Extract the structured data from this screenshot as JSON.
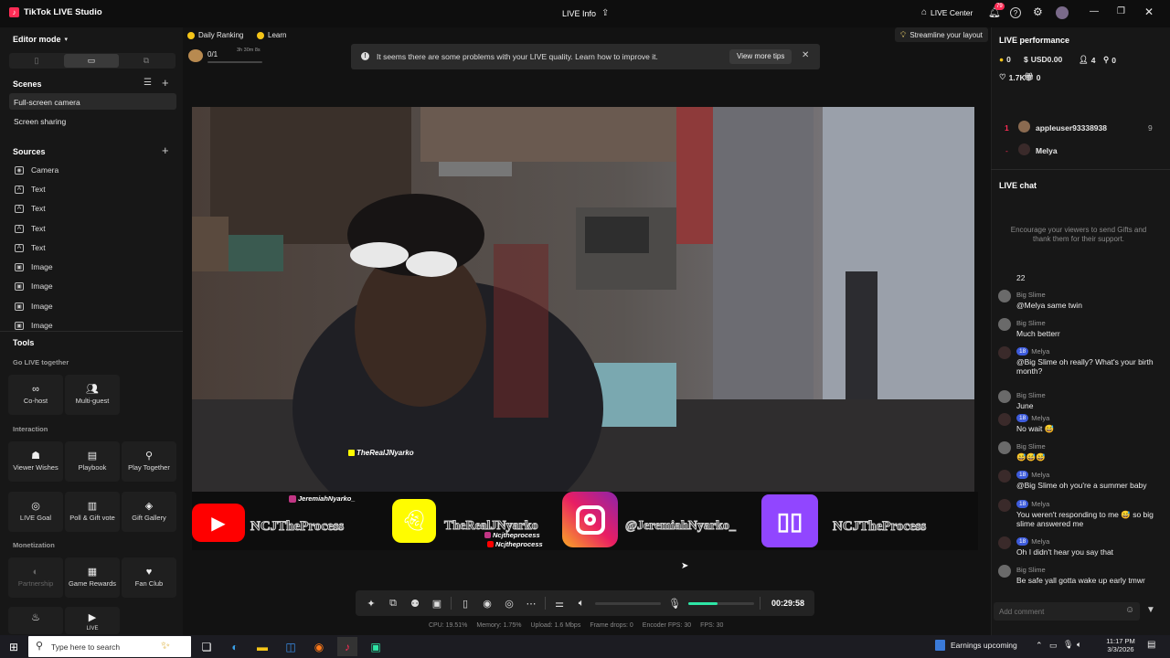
{
  "titlebar": {
    "app_name": "TikTok LIVE Studio",
    "center_title": "LIVE Info",
    "live_center": "LIVE Center",
    "notif_count": "79"
  },
  "left": {
    "editor_mode": "Editor mode",
    "scenes_title": "Scenes",
    "scenes": [
      "Full-screen camera",
      "Screen sharing"
    ],
    "sources_title": "Sources",
    "sources": [
      {
        "label": "Camera",
        "icon": "camera-icon"
      },
      {
        "label": "Text",
        "icon": "text-icon"
      },
      {
        "label": "Text",
        "icon": "text-icon"
      },
      {
        "label": "Text",
        "icon": "text-icon"
      },
      {
        "label": "Text",
        "icon": "text-icon"
      },
      {
        "label": "Image",
        "icon": "image-icon"
      },
      {
        "label": "Image",
        "icon": "image-icon"
      },
      {
        "label": "Image",
        "icon": "image-icon"
      },
      {
        "label": "Image",
        "icon": "image-icon"
      }
    ],
    "tools_title": "Tools",
    "go_live_together": "Go LIVE together",
    "cohost": "Co-host",
    "multiguest": "Multi-guest",
    "interaction": "Interaction",
    "viewer_wishes": "Viewer Wishes",
    "playbook": "Playbook",
    "play_together": "Play Together",
    "live_goal": "LIVE Goal",
    "poll_gift": "Poll & Gift vote",
    "gift_gallery": "Gift Gallery",
    "monetization": "Monetization",
    "partnership": "Partnership",
    "game_rewards": "Game Rewards",
    "fan_club": "Fan Club",
    "live_partial": "LIVE"
  },
  "center": {
    "daily_ranking": "Daily Ranking",
    "learn": "Learn",
    "goal_count": "0/1",
    "goal_time": "3h 30m 8s",
    "alert_text": "It seems there are some problems with your LIVE quality. Learn how to improve it.",
    "view_more_tips": "View more tips",
    "streamline": "Streamline your layout",
    "overlay_name": "TheRealJNyarko",
    "banner": {
      "ig_small": "JeremiahNyarko_",
      "youtube_name": "NCJTheProcess",
      "snap_name": "TheRealJNyarko",
      "snap_sub1": "Ncjtheprocess",
      "snap_sub2": "Ncjtheprocess",
      "ig_name": "@JeremiahNyarko_",
      "twitch_name": "NCJTheProcess"
    },
    "timer": "00:29:58",
    "mic_level": 0.45,
    "stats": {
      "cpu": "CPU: 19.51%",
      "memory": "Memory: 1.75%",
      "upload": "Upload: 1.6 Mbps",
      "drops": "Frame drops: 0",
      "enc_fps": "Encoder FPS: 30",
      "fps": "FPS: 30"
    }
  },
  "right": {
    "perf_title": "LIVE performance",
    "coins": "0",
    "usd": "USD0.00",
    "viewers": "4",
    "new_followers": "0",
    "likes": "1.7K",
    "gifts": "0",
    "rank1_num": "1",
    "rank1_name": "appleuser93338938",
    "rank1_score": "9",
    "rank2_num": "-",
    "rank2_name": "Melya",
    "chat_title": "LIVE chat",
    "chat_hint": "Encourage your viewers to send Gifts and thank them for their support.",
    "partial_msg": "22",
    "messages": [
      {
        "name": "Big Slime",
        "badge": "",
        "text": "@Melya same twin"
      },
      {
        "name": "Big Slime",
        "badge": "",
        "text": "Much betterr"
      },
      {
        "name": "Melya",
        "badge": "18",
        "text": "@Big Slime oh really? What's your birth month?"
      },
      {
        "name": "Big Slime",
        "badge": "",
        "text": "June"
      },
      {
        "name": "Melya",
        "badge": "18",
        "text": "No wait 😅"
      },
      {
        "name": "Big Slime",
        "badge": "",
        "text": "😅😅😅"
      },
      {
        "name": "Melya",
        "badge": "18",
        "text": "@Big Slime oh you're a summer baby"
      },
      {
        "name": "Melya",
        "badge": "18",
        "text": "You weren't responding to me 😅 so big slime answered me"
      },
      {
        "name": "Melya",
        "badge": "18",
        "text": "Oh I didn't hear you say that"
      },
      {
        "name": "Big Slime",
        "badge": "",
        "text": "Be safe yall gotta wake up early tmwr"
      }
    ],
    "add_comment": "Add comment"
  },
  "taskbar": {
    "search": "Type here to search",
    "earnings": "Earnings upcoming",
    "time": "11:17 PM",
    "date": "3/3/2026"
  },
  "colors": {
    "accent_pink": "#fe2c55",
    "mic_green": "#2ee6a6",
    "badge_blue": "#3d5bdb"
  }
}
